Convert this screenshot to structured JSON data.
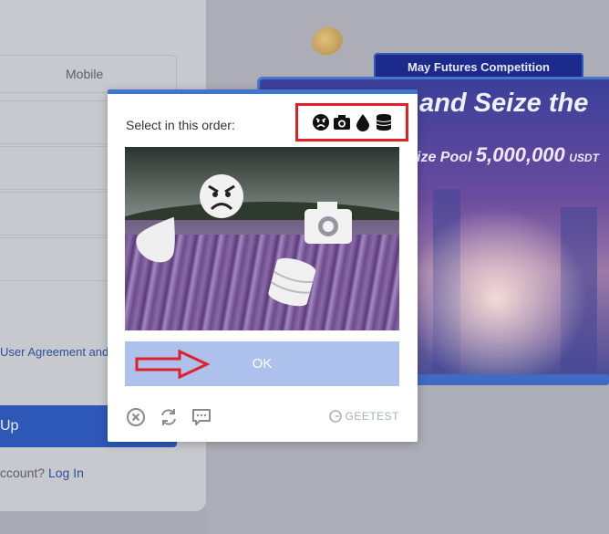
{
  "background_page": {
    "tab_mobile": "Mobile",
    "agreement_text": "User Agreement and",
    "signup_label": "Up",
    "account_prompt": "ccount?",
    "login_link": "Log In"
  },
  "banner": {
    "tab_title": "May Futures Competition",
    "headline": "and Seize the",
    "prize_label": "ize Pool",
    "prize_amount": "5,000,000",
    "prize_unit": "USDT"
  },
  "captcha": {
    "prompt": "Select in this order:",
    "order_icons": [
      "angry-face-icon",
      "camera-icon",
      "drop-icon",
      "coin-stack-icon"
    ],
    "ok_label": "OK",
    "tools": [
      "close-icon",
      "refresh-icon",
      "feedback-icon"
    ],
    "brand": "GEETEST",
    "colors": {
      "accent": "#3f74d1",
      "ok_bg": "#adc1ec",
      "highlight": "#e0202a"
    }
  }
}
